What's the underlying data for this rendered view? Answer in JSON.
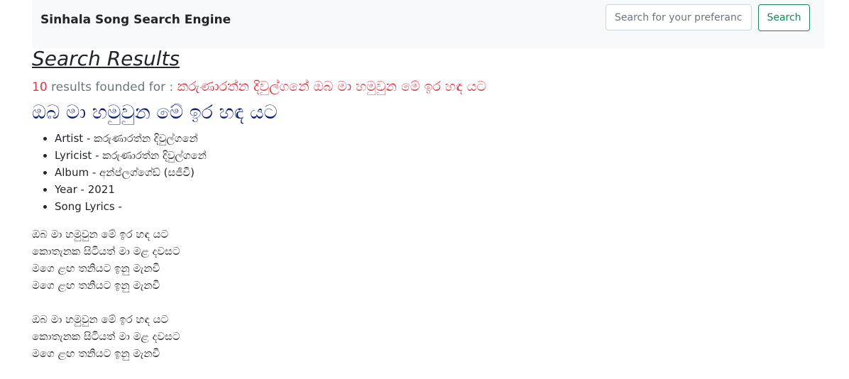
{
  "navbar": {
    "brand": "Sinhala Song Search Engine",
    "search_placeholder": "Search for your preferance",
    "search_button_label": "Search"
  },
  "results": {
    "heading": "Search Results",
    "count": "10",
    "founded_text": "results founded for :",
    "query": "කරුණාරත්න දිවුල්ගනේ ඔබ මා හමුවුන මේ ඉර හඳ යට"
  },
  "song": {
    "title": "ඔබ මා හමුවුන මේ ඉර හඳ යට",
    "artist": "Artist - කරුණාරත්න දිවුල්ගනේ",
    "lyricist": "Lyricist - කරුණාරත්න දිවුල්ගනේ",
    "album": "Album - අන්ප්ලග්ගේඩ් (සජීවී)",
    "year": "Year - 2021",
    "lyrics_label": "Song Lyrics -",
    "lyrics": {
      "stanza1": [
        "ඔබ මා හමුවුන මේ ඉර හඳ යට",
        "කොතැනක සිටියත් මා මළ දවසට",
        "මගෙ ළඟ තනියට ඉනු මැනවී",
        "මගෙ ළඟ තනියට ඉනු මැනවී"
      ],
      "stanza2": [
        "ඔබ මා හමුවුන මේ ඉර හඳ යට",
        "කොතැනක සිටියත් මා මළ දවසට",
        "මගෙ ළඟ තනියට ඉනු මැනවී"
      ]
    }
  },
  "colors": {
    "navbar_bg": "#f8f9fa",
    "accent_green": "#198754",
    "count_red": "#dc3545",
    "title_navy": "#0d1e7a"
  }
}
